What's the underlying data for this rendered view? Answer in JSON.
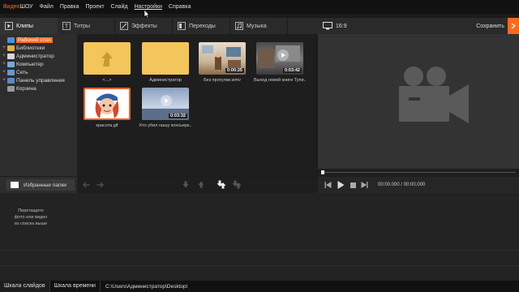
{
  "app": {
    "logo_part1": "Видео",
    "logo_part2": "ШОУ"
  },
  "menu": [
    "Файл",
    "Правка",
    "Проект",
    "Слайд",
    "Настройки",
    "Справка"
  ],
  "tabs": [
    {
      "label": "Клипы",
      "icon": "play-icon"
    },
    {
      "label": "Титры",
      "icon": "text-icon"
    },
    {
      "label": "Эффекты",
      "icon": "wand-icon"
    },
    {
      "label": "Переходы",
      "icon": "transition-icon"
    },
    {
      "label": "Музыка",
      "icon": "music-icon"
    }
  ],
  "tree": [
    {
      "label": "Рабочий стол",
      "expander": "",
      "selected": true,
      "color": "#4a90d9"
    },
    {
      "label": "Библиотеки",
      "expander": "+",
      "color": "#e0b050"
    },
    {
      "label": "Администратор",
      "expander": "+",
      "color": "#d8d8d8"
    },
    {
      "label": "Компьютер",
      "expander": "+",
      "color": "#7aa8d8"
    },
    {
      "label": "Сеть",
      "expander": "+",
      "color": "#6a9ac8"
    },
    {
      "label": "Панель управления",
      "expander": "+",
      "color": "#5a8ac0"
    },
    {
      "label": "Корзина",
      "expander": "",
      "color": "#999"
    }
  ],
  "files": [
    {
      "name": "<...>",
      "type": "up-folder"
    },
    {
      "name": "Администратор",
      "type": "folder"
    },
    {
      "name": "Без прогулки.wmv",
      "duration": "0:00:25",
      "type": "video"
    },
    {
      "name": "Выход новой книги Тупи...",
      "duration": "0:03:42",
      "type": "video"
    },
    {
      "name": "красота.gif",
      "type": "image"
    },
    {
      "name": "Кто убил нашу консьерк...",
      "duration": "0:03:32",
      "type": "video"
    }
  ],
  "preview": {
    "aspect": "16:9",
    "save_label": "Сохранить",
    "time": "00:00.000 / 00:00.000"
  },
  "favorites_label": "Избранные папки",
  "timeline_hint": [
    "Перетащите",
    "фото или видео",
    "из списка выше"
  ],
  "status": {
    "tab_slides": "Шкала слайдов",
    "tab_timeline": "Шкала времени",
    "path": "C:\\Users\\Администратор\\Desktop\\"
  },
  "colors": {
    "accent": "#ff6a1a",
    "selected_border": "#e8612c"
  }
}
